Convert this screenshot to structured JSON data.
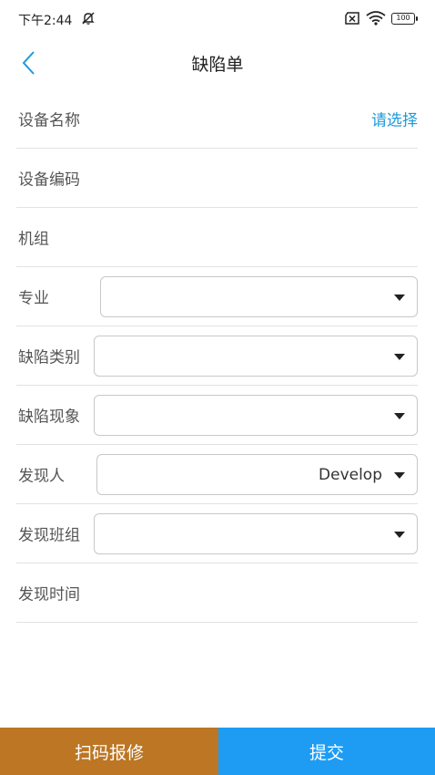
{
  "status_bar": {
    "time": "下午2:44",
    "battery": "100",
    "icons": [
      "mute-bell-icon",
      "sim-off-icon",
      "wifi-icon",
      "battery-icon"
    ]
  },
  "nav": {
    "title": "缺陷单",
    "back_icon": "chevron-left-icon",
    "accent_color": "#1c9bd8"
  },
  "form": {
    "device_name": {
      "label": "设备名称",
      "action": "请选择"
    },
    "device_code": {
      "label": "设备编码"
    },
    "unit": {
      "label": "机组"
    },
    "specialty": {
      "label": "专业",
      "value": ""
    },
    "defect_category": {
      "label": "缺陷类别",
      "value": ""
    },
    "defect_phenomenon": {
      "label": "缺陷现象",
      "value": ""
    },
    "discoverer": {
      "label": "发现人",
      "value": "Develop"
    },
    "discovery_team": {
      "label": "发现班组",
      "value": ""
    },
    "discovery_time": {
      "label": "发现时间"
    }
  },
  "bottom": {
    "scan_label": "扫码报修",
    "submit_label": "提交",
    "scan_color": "#bc7624",
    "submit_color": "#1e9cf3"
  }
}
